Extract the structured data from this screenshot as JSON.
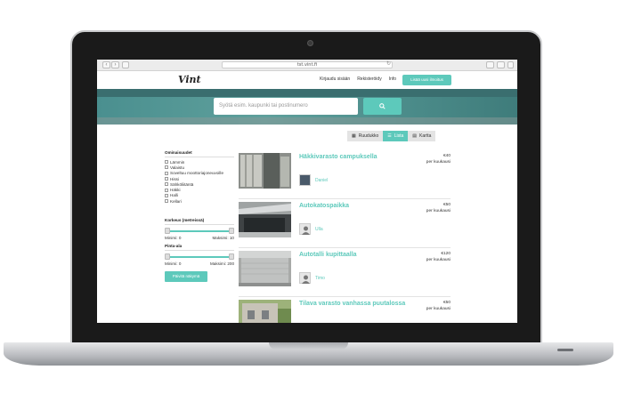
{
  "browser": {
    "url": "tst.vint.fi",
    "back_glyph": "‹",
    "forward_glyph": "›",
    "reload_glyph": "↻"
  },
  "header": {
    "logo": "Vint",
    "links": [
      "Kirjaudu sisään",
      "Rekisteröidy",
      "Info"
    ],
    "add_button": "Lisää uusi ilmoitus"
  },
  "search": {
    "placeholder": "Syötä esim. kaupunki tai postinumero"
  },
  "views": [
    {
      "label": "Ruudukko",
      "icon": "grid-icon",
      "active": false
    },
    {
      "label": "Lista",
      "icon": "list-icon",
      "active": true
    },
    {
      "label": "Kartta",
      "icon": "map-icon",
      "active": false
    }
  ],
  "filters": {
    "features_title": "Ominaisuudet",
    "features": [
      "Lämmin",
      "Valaistu",
      "Soveltuu moottoriajoneuvoille",
      "Hissi",
      "Sähköliitäntä",
      "Häkki",
      "Halli",
      "Kellari"
    ],
    "height_title": "Korkeus (metreissä)",
    "height_min_label": "Minimi: 0",
    "height_max_label": "Maksimi: 10",
    "height_range": [
      0,
      10
    ],
    "area_title": "Pinta-ala",
    "area_min_label": "Minimi: 0",
    "area_max_label": "Maksimi: 200",
    "area_range": [
      0,
      200
    ],
    "save_button": "Päivitä näkymä"
  },
  "listings": [
    {
      "title": "Häkkivarasto campuksella",
      "price": "€40",
      "period": "per kuukausi",
      "user": "Daniel"
    },
    {
      "title": "Autokatospaikka",
      "price": "€50",
      "period": "per kuukausi",
      "user": "Ulla"
    },
    {
      "title": "Autotalli kupittaalla",
      "price": "€120",
      "period": "per kuukausi",
      "user": "Timo"
    },
    {
      "title": "Tilava varasto vanhassa puutalossa",
      "price": "€50",
      "period": "per kuukausi",
      "user": ""
    }
  ],
  "colors": {
    "accent": "#5dc9bb",
    "hero": "#4a8f8f"
  }
}
